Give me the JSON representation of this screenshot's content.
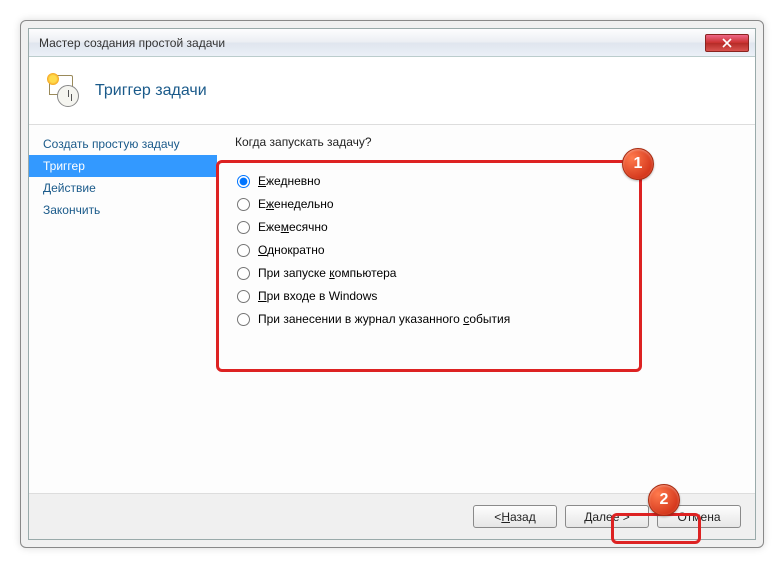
{
  "window": {
    "title": "Мастер создания простой задачи"
  },
  "header": {
    "title": "Триггер задачи"
  },
  "sidebar": {
    "items": [
      {
        "label": "Создать простую задачу",
        "selected": false
      },
      {
        "label": "Триггер",
        "selected": true
      },
      {
        "label": "Действие",
        "selected": false
      },
      {
        "label": "Закончить",
        "selected": false
      }
    ]
  },
  "main": {
    "question": "Когда запускать задачу?",
    "options": [
      {
        "pre": "",
        "ul": "Е",
        "post": "жедневно",
        "checked": true
      },
      {
        "pre": "Е",
        "ul": "ж",
        "post": "енедельно",
        "checked": false
      },
      {
        "pre": "Еже",
        "ul": "м",
        "post": "есячно",
        "checked": false
      },
      {
        "pre": "",
        "ul": "О",
        "post": "днократно",
        "checked": false
      },
      {
        "pre": "При запуске ",
        "ul": "к",
        "post": "омпьютера",
        "checked": false
      },
      {
        "pre": "",
        "ul": "П",
        "post": "ри входе в Windows",
        "checked": false
      },
      {
        "pre": "При занесении в журнал указанного ",
        "ul": "с",
        "post": "обытия",
        "checked": false
      }
    ]
  },
  "footer": {
    "back": {
      "pre": "< ",
      "ul": "Н",
      "post": "азад"
    },
    "next": {
      "pre": "",
      "ul": "Д",
      "post": "алее >"
    },
    "cancel": "Отмена"
  },
  "annotations": {
    "badge1": "1",
    "badge2": "2"
  }
}
